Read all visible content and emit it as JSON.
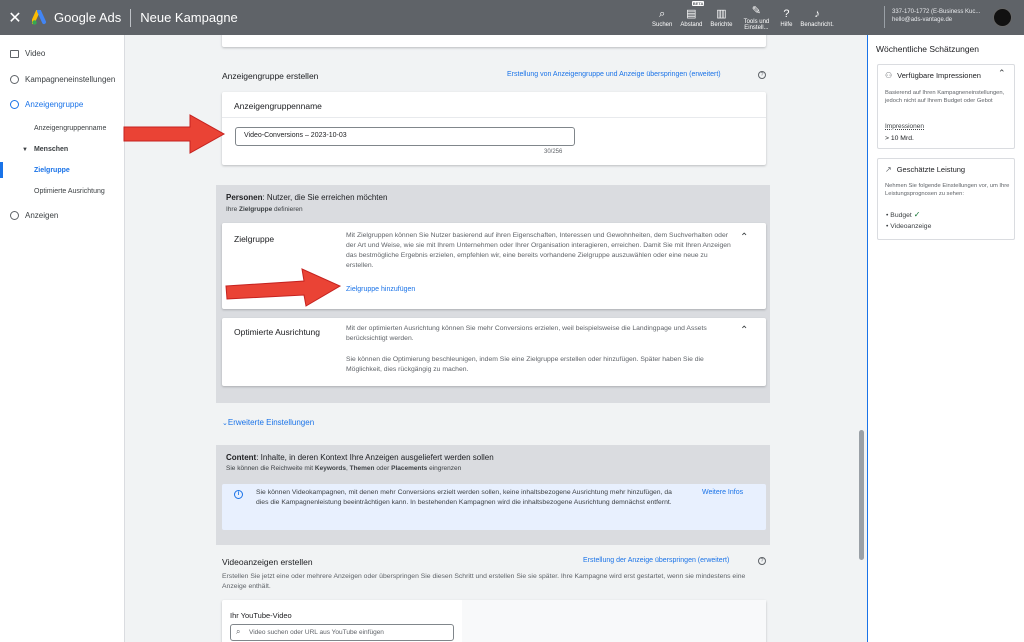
{
  "header": {
    "close": "✕",
    "brand": "Google Ads",
    "campaign_title": "Neue Kampagne",
    "tools": [
      {
        "icon": "search-icon",
        "glyph": "⌕",
        "label": "Suchen"
      },
      {
        "icon": "appearance-icon",
        "glyph": "▤",
        "label": "Abstand",
        "badge": "BETA"
      },
      {
        "icon": "reports-icon",
        "glyph": "▥",
        "label": "Berichte"
      },
      {
        "icon": "wrench-icon",
        "glyph": "✎",
        "label": "Tools und Einstell..."
      },
      {
        "icon": "help-icon",
        "glyph": "?",
        "label": "Hilfe"
      },
      {
        "icon": "bell-icon",
        "glyph": "♪",
        "label": "Benachricht."
      }
    ],
    "account_line1": "337-170-1772 (E-Business Kuc...",
    "account_line2": "hello@ads-vantage.de"
  },
  "sidebar": {
    "items": [
      {
        "label": "Video"
      },
      {
        "label": "Kampagneneinstellungen"
      },
      {
        "label": "Anzeigengruppe"
      },
      {
        "label": "Anzeigen"
      }
    ],
    "sub": {
      "name": "Anzeigengruppenname",
      "people": "Menschen",
      "audience": "Zielgruppe",
      "optimized": "Optimierte Ausrichtung"
    }
  },
  "main": {
    "adgroup_section_title": "Anzeigengruppe erstellen",
    "skip_adgroup_link": "Erstellung von Anzeigengruppe und Anzeige überspringen (erweitert)",
    "adgroup_name_label": "Anzeigengruppenname",
    "adgroup_name_value": "Video-Conversions – 2023-10-03",
    "char_count": "30/256",
    "people_title_bold": "Personen",
    "people_title_rest": ": Nutzer, die Sie erreichen möchten",
    "people_sub_pre": "Ihre ",
    "people_sub_bold": "Zielgruppe",
    "people_sub_post": " definieren",
    "audience_title": "Zielgruppe",
    "audience_text": "Mit Zielgruppen können Sie Nutzer basierend auf ihren Eigenschaften, Interessen und Gewohnheiten, dem Suchverhalten oder der Art und Weise, wie sie mit Ihrem Unternehmen oder Ihrer Organisation interagieren, erreichen. Damit Sie mit Ihren Anzeigen das bestmögliche Ergebnis erzielen, empfehlen wir, eine bereits vorhandene Zielgruppe auszuwählen oder eine neue zu erstellen.",
    "add_audience_link": "Zielgruppe hinzufügen",
    "optimized_title": "Optimierte Ausrichtung",
    "optimized_text1": "Mit der optimierten Ausrichtung können Sie mehr Conversions erzielen, weil beispielsweise die Landingpage und Assets berücksichtigt werden.",
    "optimized_text2": "Sie können die Optimierung beschleunigen, indem Sie eine Zielgruppe erstellen oder hinzufügen. Später haben Sie die Möglichkeit, dies rückgängig zu machen.",
    "advanced_settings": "Erweiterte Einstellungen",
    "content_title_bold": "Content",
    "content_title_rest": ": Inhalte, in deren Kontext Ihre Anzeigen ausgeliefert werden sollen",
    "content_sub_pre": "Sie können die Reichweite mit ",
    "content_sub_k": "Keywords",
    "content_sub_c1": ", ",
    "content_sub_t": "Themen",
    "content_sub_c2": " oder ",
    "content_sub_p": "Placements",
    "content_sub_post": " eingrenzen",
    "info_text": "Sie können Videokampagnen, mit denen mehr Conversions erzielt werden sollen, keine inhaltsbezogene Ausrichtung mehr hinzufügen, da dies die Kampagnenleistung beeinträchtigen kann. In bestehenden Kampagnen wird die inhaltsbezogene Ausrichtung demnächst entfernt.",
    "info_link": "Weitere Infos",
    "video_section_title": "Videoanzeigen erstellen",
    "skip_ad_link": "Erstellung der Anzeige überspringen (erweitert)",
    "video_section_text": "Erstellen Sie jetzt eine oder mehrere Anzeigen oder überspringen Sie diesen Schritt und erstellen Sie sie später. Ihre Kampagne wird erst gestartet, wenn sie mindestens eine Anzeige enthält.",
    "youtube_label": "Ihr YouTube-Video",
    "youtube_placeholder": "Video suchen oder URL aus YouTube einfügen"
  },
  "right_panel": {
    "title": "Wöchentliche Schätzungen",
    "impressions_title": "Verfügbare Impressionen",
    "impressions_text": "Basierend auf Ihren Kampagneneinstellungen, jedoch nicht auf Ihrem Budget oder Gebot",
    "impressions_label": "Impressionen",
    "impressions_value": "> 10 Mrd.",
    "performance_title": "Geschätzte Leistung",
    "performance_text": "Nehmen Sie folgende Einstellungen vor, um Ihre Leistungsprognosen zu sehen:",
    "perf_items": [
      {
        "label": "Budget",
        "done": "✓"
      },
      {
        "label": "Videoanzeige",
        "done": ""
      }
    ]
  },
  "colors": {
    "accent": "#1a73e8",
    "arrow": "#ea4335",
    "topbar": "#5f6368"
  }
}
